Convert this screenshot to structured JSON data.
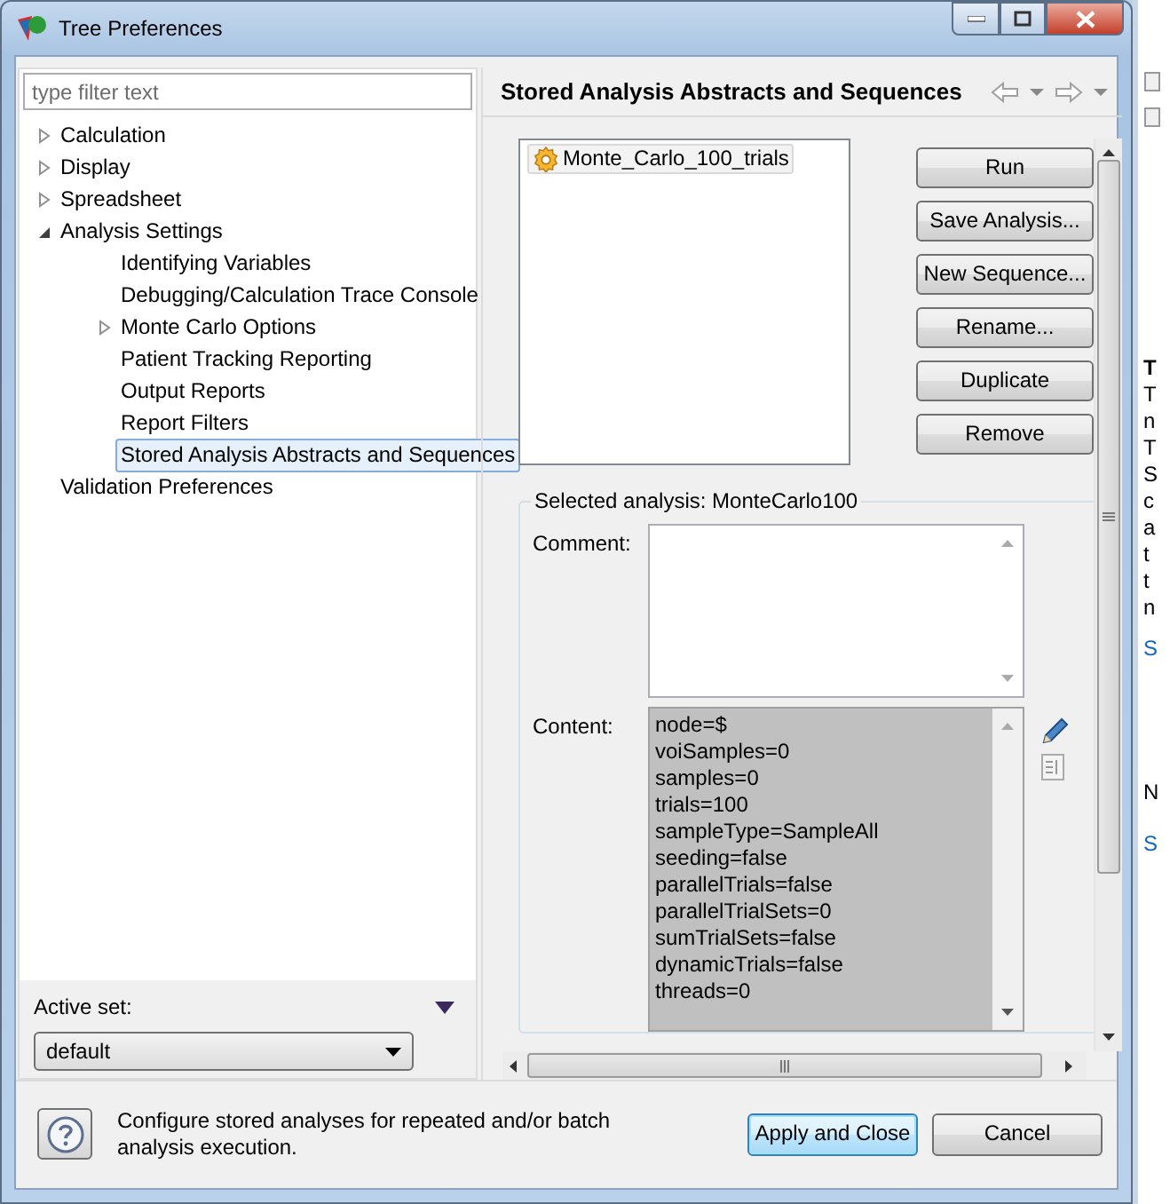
{
  "window": {
    "title": "Tree Preferences"
  },
  "filter": {
    "placeholder": "type filter text"
  },
  "tree": [
    {
      "label": "Calculation",
      "kind": "branch",
      "expanded": false,
      "selected": false
    },
    {
      "label": "Display",
      "kind": "branch",
      "expanded": false,
      "selected": false
    },
    {
      "label": "Spreadsheet",
      "kind": "branch",
      "expanded": false,
      "selected": false
    },
    {
      "label": "Analysis Settings",
      "kind": "branch",
      "expanded": true,
      "selected": false,
      "children": [
        {
          "label": "Identifying Variables",
          "kind": "leaf",
          "selected": false
        },
        {
          "label": "Debugging/Calculation Trace Console",
          "kind": "leaf",
          "selected": false
        },
        {
          "label": "Monte Carlo Options",
          "kind": "branch",
          "expanded": false,
          "selected": false
        },
        {
          "label": "Patient Tracking Reporting",
          "kind": "leaf",
          "selected": false
        },
        {
          "label": "Output Reports",
          "kind": "leaf",
          "selected": false
        },
        {
          "label": "Report Filters",
          "kind": "leaf",
          "selected": false
        },
        {
          "label": "Stored Analysis Abstracts and Sequences",
          "kind": "leaf",
          "selected": true
        }
      ]
    },
    {
      "label": "Validation Preferences",
      "kind": "leaf",
      "selected": false
    }
  ],
  "active_set": {
    "label": "Active set:",
    "value": "default"
  },
  "page": {
    "title": "Stored Analysis Abstracts and Sequences"
  },
  "analyses": [
    {
      "label": "Monte_Carlo_100_trials",
      "selected": true
    }
  ],
  "actions": [
    {
      "label": "Run"
    },
    {
      "label": "Save Analysis..."
    },
    {
      "label": "New Sequence..."
    },
    {
      "label": "Rename..."
    },
    {
      "label": "Duplicate"
    },
    {
      "label": "Remove"
    }
  ],
  "selected_analysis": {
    "legend": "Selected analysis: MonteCarlo100",
    "comment_label": "Comment:",
    "content_label": "Content:",
    "content_lines": [
      "node=$",
      "voiSamples=0",
      "samples=0",
      "trials=100",
      "sampleType=SampleAll",
      "seeding=false",
      "parallelTrials=false",
      "parallelTrialSets=0",
      "sumTrialSets=false",
      "dynamicTrials=false",
      "threads=0"
    ]
  },
  "footer": {
    "description": "Configure stored analyses for repeated and/or batch analysis execution.",
    "buttons": [
      {
        "label": "Apply and Close",
        "default": true
      },
      {
        "label": "Cancel",
        "default": false
      }
    ]
  },
  "background_window": {
    "fragments": [
      {
        "text": "T",
        "kind": "heading"
      },
      {
        "text": "T",
        "kind": "text"
      },
      {
        "text": "n",
        "kind": "text"
      },
      {
        "text": "T",
        "kind": "text"
      },
      {
        "text": "S",
        "kind": "text"
      },
      {
        "text": "c",
        "kind": "text"
      },
      {
        "text": "a",
        "kind": "text"
      },
      {
        "text": "t",
        "kind": "text"
      },
      {
        "text": "t",
        "kind": "text"
      },
      {
        "text": "n",
        "kind": "text"
      },
      {
        "text": "S",
        "kind": "link"
      },
      {
        "text": "N",
        "kind": "text"
      },
      {
        "text": "S",
        "kind": "link"
      }
    ]
  }
}
